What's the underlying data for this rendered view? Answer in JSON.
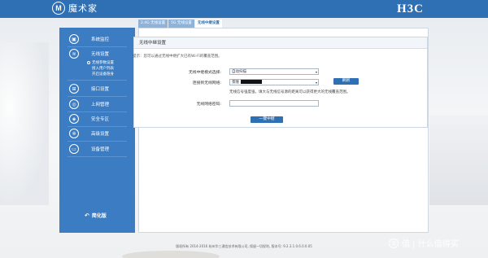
{
  "header": {
    "logo_mark": "M",
    "logo_text": "魔术家",
    "brand": "H3C"
  },
  "tabs": [
    {
      "label": "2.4G 无线设置",
      "active": false
    },
    {
      "label": "5G 无线设置",
      "active": false
    },
    {
      "label": "无线中继设置",
      "active": true
    }
  ],
  "sidebar": {
    "items": [
      {
        "label": "系统监控",
        "icon": "monitor-icon"
      },
      {
        "label": "无线设置",
        "icon": "wifi-icon"
      },
      {
        "label": "接口设置",
        "icon": "interface-icon"
      },
      {
        "label": "上网管理",
        "icon": "internet-icon"
      },
      {
        "label": "安全专区",
        "icon": "shield-icon"
      },
      {
        "label": "高级设置",
        "icon": "gear-icon"
      },
      {
        "label": "设备管理",
        "icon": "device-icon"
      }
    ],
    "sub_items": [
      {
        "label": "无线参数设置",
        "selected": true
      },
      {
        "label": "接入用户列表",
        "selected": false
      },
      {
        "label": "开启设备隐身",
        "selected": false
      }
    ],
    "simplify_label": "简化版"
  },
  "panel": {
    "title": "无线中继设置",
    "hint": "提示：您可以通过无线中继扩大已有Wi-Fi的覆盖范围。",
    "mode_label": "无线中继模式选择:",
    "mode_value": "自动扫描",
    "network_label": "连接到无线网络:",
    "network_value": "景隆",
    "refresh_label": "刷新",
    "signal_note": "无线信号强度强，填大与无线信号源的距离可以获得更大的无线覆盖范围。",
    "password_label": "无线网络密码:",
    "password_value": "",
    "submit_label": "一键中继"
  },
  "footer": {
    "text": "版权所有 2014-2016 杭州华三通信技术有限公司, 保留一切权利, 版本号: 9.2.3.1.0.6.0.0.05"
  },
  "watermark": {
    "text": "值 | 什么值得买"
  }
}
